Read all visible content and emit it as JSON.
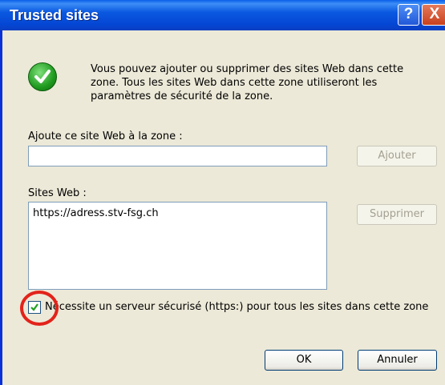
{
  "dialog": {
    "title": "Trusted sites",
    "help_glyph": "?",
    "close_glyph": "X",
    "intro_text": "Vous pouvez ajouter ou supprimer des sites Web dans cette zone. Tous les sites Web dans cette zone utiliseront les paramètres de sécurité de la zone.",
    "icon": "green-check-icon"
  },
  "add_site": {
    "label": "Ajoute ce site Web à la zone :",
    "value": "",
    "button_label": "Ajouter"
  },
  "sites": {
    "label": "Sites Web :",
    "items": [
      "https://adress.stv-fsg.ch"
    ],
    "remove_button_label": "Supprimer"
  },
  "https_option": {
    "checked": true,
    "label": "Nécessite un serveur sécurisé (https:) pour tous les sites dans cette zone"
  },
  "footer": {
    "ok_label": "OK",
    "cancel_label": "Annuler"
  },
  "colors": {
    "titlebar": "#0b59e0",
    "dialog_bg": "#ece9d8",
    "highlight_circle": "#e2231a"
  }
}
